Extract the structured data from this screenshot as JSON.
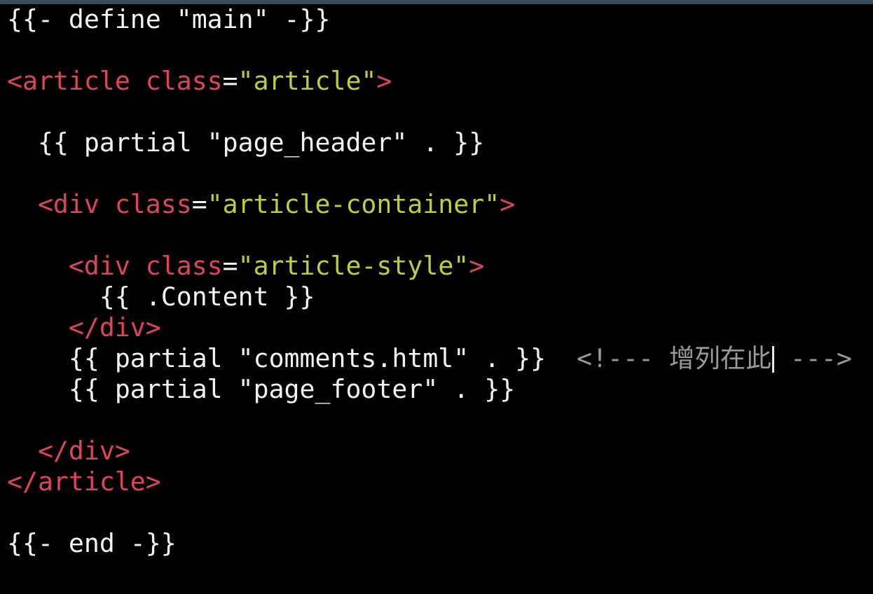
{
  "editor": {
    "lines": [
      {
        "segments": [
          {
            "kind": "txt",
            "text": "{{- define \"main\" -}}"
          }
        ]
      },
      {
        "segments": []
      },
      {
        "segments": [
          {
            "kind": "tag",
            "text": "<article "
          },
          {
            "kind": "tag",
            "text": "class"
          },
          {
            "kind": "txt",
            "text": "="
          },
          {
            "kind": "str",
            "text": "\"article\""
          },
          {
            "kind": "tag",
            "text": ">"
          }
        ]
      },
      {
        "segments": []
      },
      {
        "segments": [
          {
            "kind": "txt",
            "text": "  {{ partial \"page_header\" . }}"
          }
        ]
      },
      {
        "segments": []
      },
      {
        "segments": [
          {
            "kind": "tag",
            "text": "  <div "
          },
          {
            "kind": "tag",
            "text": "class"
          },
          {
            "kind": "txt",
            "text": "="
          },
          {
            "kind": "str",
            "text": "\"article-container\""
          },
          {
            "kind": "tag",
            "text": ">"
          }
        ]
      },
      {
        "segments": []
      },
      {
        "segments": [
          {
            "kind": "tag",
            "text": "    <div "
          },
          {
            "kind": "tag",
            "text": "class"
          },
          {
            "kind": "txt",
            "text": "="
          },
          {
            "kind": "str",
            "text": "\"article-style\""
          },
          {
            "kind": "tag",
            "text": ">"
          }
        ]
      },
      {
        "segments": [
          {
            "kind": "txt",
            "text": "      {{ .Content }}"
          }
        ]
      },
      {
        "segments": [
          {
            "kind": "tag",
            "text": "    </div>"
          }
        ]
      },
      {
        "segments": [
          {
            "kind": "txt",
            "text": "    {{ partial \"comments.html\" . }}  "
          },
          {
            "kind": "cmt",
            "text": "<!--- 增列在此"
          },
          {
            "kind": "caret",
            "text": ""
          },
          {
            "kind": "cmt",
            "text": " --->"
          }
        ]
      },
      {
        "segments": [
          {
            "kind": "txt",
            "text": "    {{ partial \"page_footer\" . }}"
          }
        ]
      },
      {
        "segments": []
      },
      {
        "segments": [
          {
            "kind": "tag",
            "text": "  </div>"
          }
        ]
      },
      {
        "segments": [
          {
            "kind": "tag",
            "text": "</article>"
          }
        ]
      },
      {
        "segments": []
      },
      {
        "segments": [
          {
            "kind": "txt",
            "text": "{{- end -}}"
          }
        ]
      }
    ]
  },
  "colors": {
    "background": "#000000",
    "tag": "#e0445a",
    "string": "#bfcf36",
    "text": "#f2f2f2",
    "comment": "#9a9a9a"
  }
}
